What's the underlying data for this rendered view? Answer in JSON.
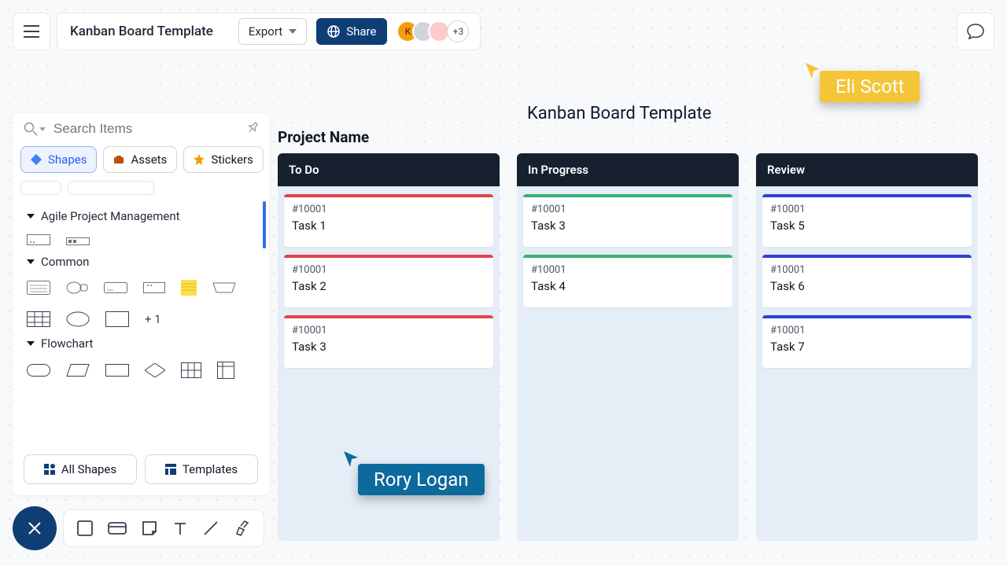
{
  "header": {
    "title": "Kanban Board Template",
    "export_label": "Export",
    "share_label": "Share",
    "avatars": [
      {
        "bg": "#f59e0b",
        "fg": "#78350f",
        "initial": "K"
      },
      {
        "bg": "#d1d5db",
        "fg": "#374151",
        "initial": ""
      },
      {
        "bg": "#fecaca",
        "fg": "#7f1d1d",
        "initial": ""
      }
    ],
    "more_avatars": "+3"
  },
  "sidebar": {
    "search_placeholder": "Search Items",
    "tabs": {
      "shapes": "Shapes",
      "assets": "Assets",
      "stickers": "Stickers"
    },
    "sections": {
      "agile": "Agile Project Management",
      "common": "Common",
      "common_more": "+ 1",
      "flowchart": "Flowchart"
    },
    "footer": {
      "all_shapes": "All Shapes",
      "templates": "Templates"
    }
  },
  "canvas": {
    "main_title": "Kanban Board Template",
    "project_name": "Project Name",
    "status_colors": {
      "todo": "#e1434a",
      "inprogress": "#3bb273",
      "review": "#2f3fd6"
    },
    "columns": [
      {
        "title": "To Do",
        "cards": [
          {
            "id": "#10001",
            "title": "Task 1"
          },
          {
            "id": "#10001",
            "title": "Task 2"
          },
          {
            "id": "#10001",
            "title": "Task 3"
          }
        ]
      },
      {
        "title": "In Progress",
        "cards": [
          {
            "id": "#10001",
            "title": "Task 3"
          },
          {
            "id": "#10001",
            "title": "Task 4"
          }
        ]
      },
      {
        "title": "Review",
        "cards": [
          {
            "id": "#10001",
            "title": "Task 5"
          },
          {
            "id": "#10001",
            "title": "Task 6"
          },
          {
            "id": "#10001",
            "title": "Task 7"
          }
        ]
      }
    ]
  },
  "cursors": {
    "rory": "Rory Logan",
    "eli": "Eli Scott"
  },
  "colors": {
    "primary_blue": "#0f3e75",
    "accent_star": "#f59e0b"
  }
}
